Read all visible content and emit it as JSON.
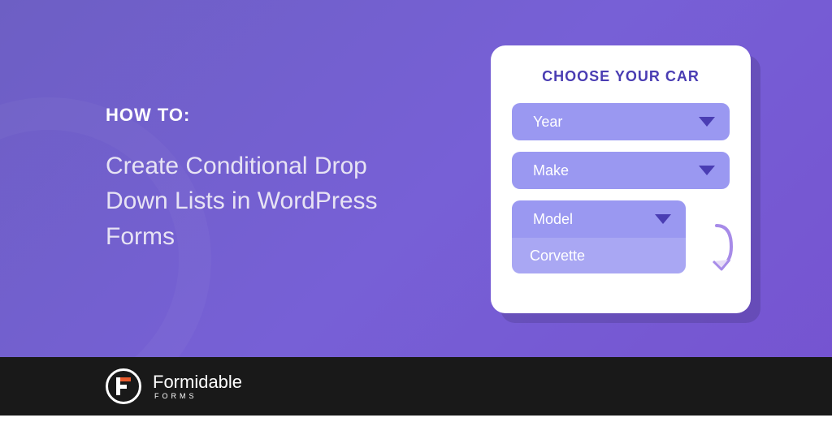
{
  "heading": {
    "howto": "HOW TO:",
    "title": "Create Conditional Drop Down Lists in WordPress Forms"
  },
  "card": {
    "title": "CHOOSE YOUR CAR",
    "dropdowns": {
      "year": "Year",
      "make": "Make",
      "model": "Model",
      "model_option": "Corvette"
    }
  },
  "brand": {
    "name": "Formidable",
    "sub": "FORMS"
  }
}
